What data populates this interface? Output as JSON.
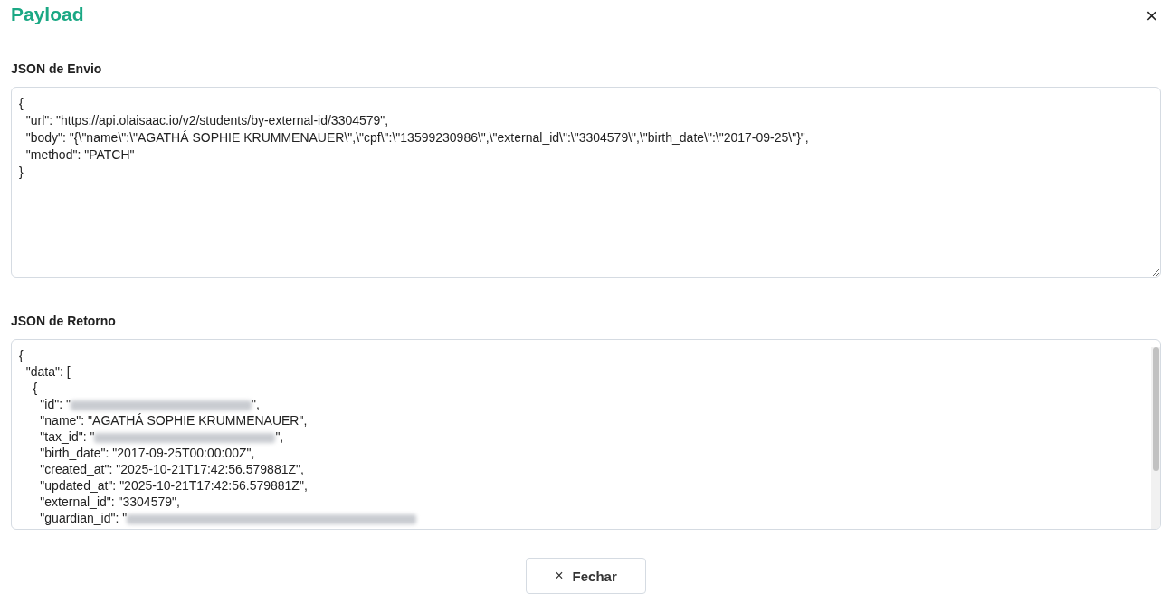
{
  "dialog": {
    "title": "Payload",
    "close": "×"
  },
  "request": {
    "label": "JSON de Envio",
    "value": "{\n  \"url\": \"https://api.olaisaac.io/v2/students/by-external-id/3304579\",\n  \"body\": \"{\\\"name\\\":\\\"AGATHÁ SOPHIE KRUMMENAUER\\\",\\\"cpf\\\":\\\"13599230986\\\",\\\"external_id\\\":\\\"3304579\\\",\\\"birth_date\\\":\\\"2017-09-25\\\"}\",\n  \"method\": \"PATCH\"\n}"
  },
  "response": {
    "label": "JSON de Retorno",
    "lines": [
      {
        "text": "{",
        "redacted": false
      },
      {
        "text": "  \"data\": [",
        "redacted": false
      },
      {
        "text": "    {",
        "redacted": false
      },
      {
        "text": "      \"id\": \"",
        "redacted": true,
        "after": "\","
      },
      {
        "text": "      \"name\": \"AGATHÁ SOPHIE KRUMMENAUER\",",
        "redacted": false
      },
      {
        "text": "      \"tax_id\": \"",
        "redacted": true,
        "after": "\","
      },
      {
        "text": "      \"birth_date\": \"2017-09-25T00:00:00Z\",",
        "redacted": false
      },
      {
        "text": "      \"created_at\": \"2025-10-21T17:42:56.579881Z\",",
        "redacted": false
      },
      {
        "text": "      \"updated_at\": \"2025-10-21T17:42:56.579881Z\",",
        "redacted": false
      },
      {
        "text": "      \"external_id\": \"3304579\",",
        "redacted": false
      },
      {
        "text": "      \"guardian_id\": \"",
        "redacted": true
      }
    ]
  },
  "footer": {
    "button": "Fechar",
    "icon": "×"
  }
}
